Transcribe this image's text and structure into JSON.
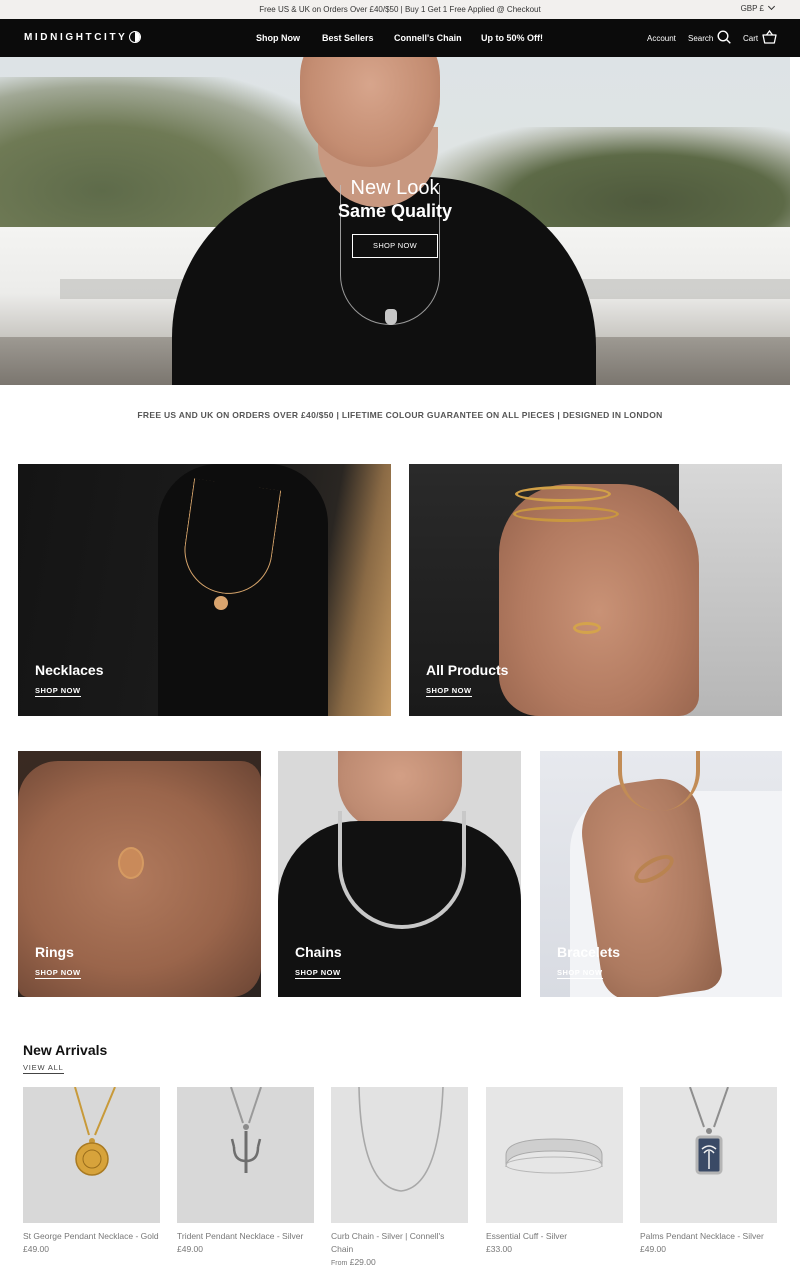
{
  "announcement": {
    "message": "Free US & UK on Orders Over £40/$50 | Buy 1 Get 1 Free Applied @ Checkout",
    "currency": "GBP £"
  },
  "header": {
    "logo": "MIDNIGHTCITY",
    "nav": [
      "Shop Now",
      "Best Sellers",
      "Connell's Chain",
      "Up to 50% Off!"
    ],
    "account": "Account",
    "search": "Search",
    "cart": "Cart"
  },
  "hero": {
    "title_line1": "New Look",
    "title_line2": "Same Quality",
    "button": "SHOP NOW"
  },
  "info_strip": "FREE US AND UK ON ORDERS OVER £40/$50 | LIFETIME COLOUR GUARANTEE ON ALL PIECES | DESIGNED IN LONDON",
  "categories": [
    {
      "label": "Necklaces",
      "link": "SHOP NOW"
    },
    {
      "label": "All Products",
      "link": "SHOP NOW"
    },
    {
      "label": "Rings",
      "link": "SHOP NOW"
    },
    {
      "label": "Chains",
      "link": "SHOP NOW"
    },
    {
      "label": "Bracelets",
      "link": "SHOP NOW"
    }
  ],
  "new_arrivals": {
    "title": "New Arrivals",
    "view_all": "VIEW ALL",
    "products": [
      {
        "name": "St George Pendant Necklace - Gold",
        "price": "£49.00",
        "price_prefix": ""
      },
      {
        "name": "Trident Pendant Necklace - Silver",
        "price": "£49.00",
        "price_prefix": ""
      },
      {
        "name": "Curb Chain - Silver | Connell's Chain",
        "price": "£29.00",
        "price_prefix": "From"
      },
      {
        "name": "Essential Cuff - Silver",
        "price": "£33.00",
        "price_prefix": ""
      },
      {
        "name": "Palms Pendant Necklace - Silver",
        "price": "£49.00",
        "price_prefix": ""
      }
    ]
  },
  "colors": {
    "header_bg": "#0b0b0b",
    "announce_bg": "#f2f0ee",
    "text_muted": "#777777"
  }
}
